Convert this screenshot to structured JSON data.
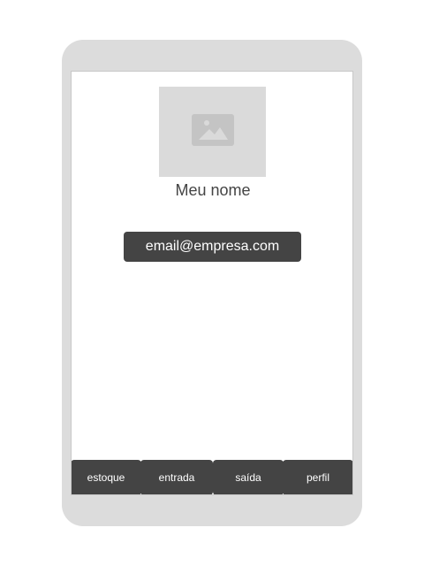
{
  "profile": {
    "avatar_icon": "image-placeholder-icon",
    "name": "Meu nome",
    "email": "email@empresa.com"
  },
  "tabs": [
    {
      "label": "estoque"
    },
    {
      "label": "entrada"
    },
    {
      "label": "saída"
    },
    {
      "label": "perfil"
    }
  ],
  "colors": {
    "device_frame": "#dcdcdc",
    "dark": "#444444",
    "placeholder_bg": "#dadada",
    "placeholder_icon": "#c4c4c4"
  }
}
